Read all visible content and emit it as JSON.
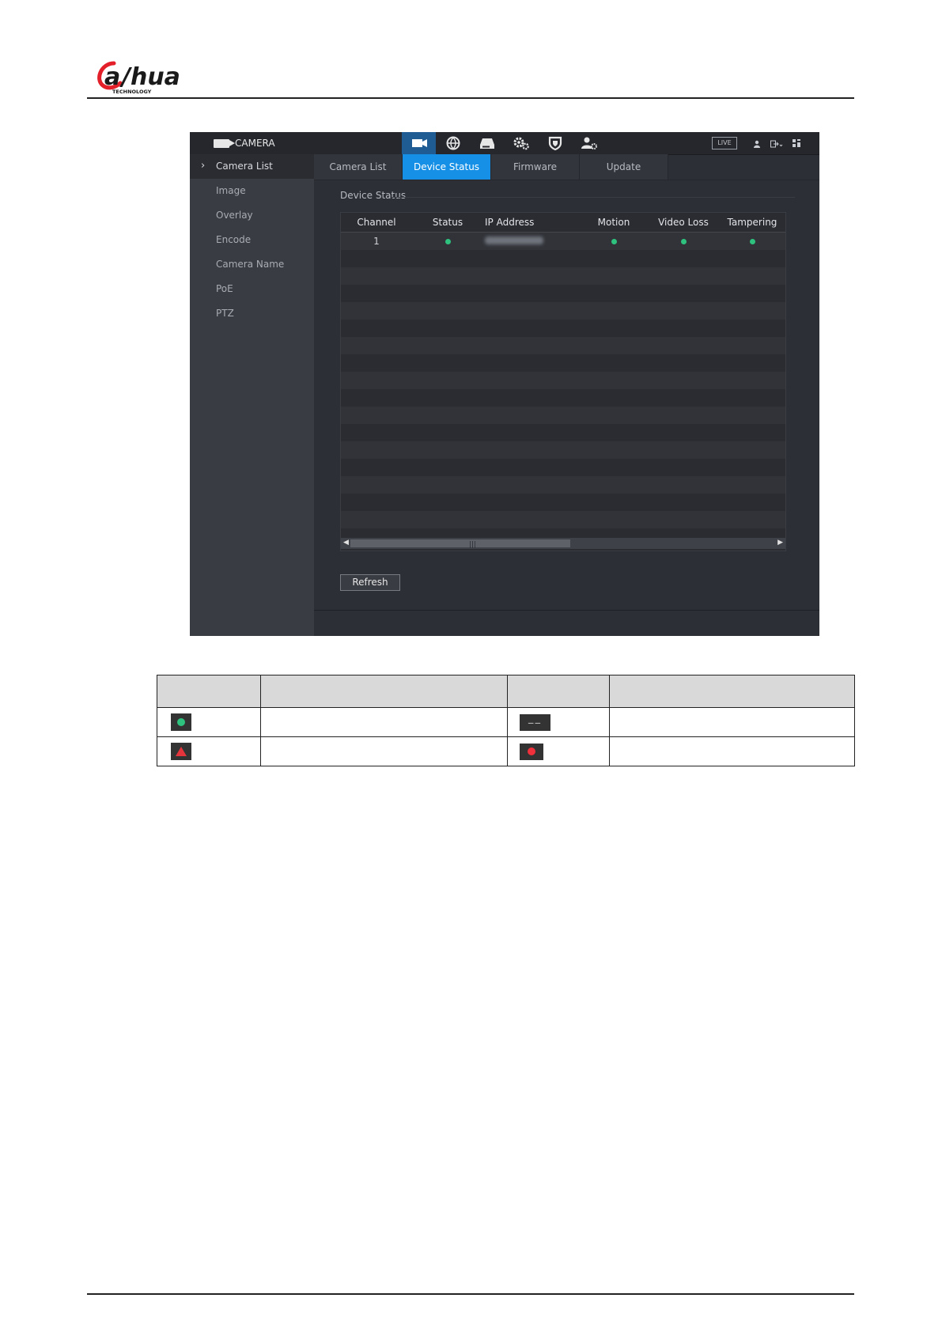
{
  "logo": {
    "text": "alhua",
    "subtext": "TECHNOLOGY"
  },
  "screen": {
    "module_title": "CAMERA",
    "nav_icons": [
      "camera-icon",
      "network-icon",
      "storage-icon",
      "system-icon",
      "security-icon",
      "account-icon"
    ],
    "live_label": "LIVE",
    "sidebar": [
      "Camera List",
      "Image",
      "Overlay",
      "Encode",
      "Camera Name",
      "PoE",
      "PTZ"
    ],
    "tabs": [
      "Camera List",
      "Device Status",
      "Firmware",
      "Update"
    ],
    "active_tab": "Device Status",
    "section_title": "Device Status",
    "table": {
      "columns": [
        "Channel",
        "Status",
        "IP Address",
        "Motion",
        "Video Loss",
        "Tampering"
      ],
      "rows": [
        {
          "channel": "1",
          "status": "online",
          "ip": "",
          "motion": "normal",
          "video_loss": "normal",
          "tampering": "normal"
        }
      ]
    },
    "refresh_label": "Refresh"
  },
  "colors": {
    "accent": "#1590e6",
    "ok": "#2ec27e",
    "alarm": "#f0303a",
    "warning": "#e5343c"
  },
  "legend_table": {
    "icons": [
      "green-dot-icon",
      "dashes-icon",
      "warning-triangle-icon",
      "red-dot-icon"
    ]
  }
}
